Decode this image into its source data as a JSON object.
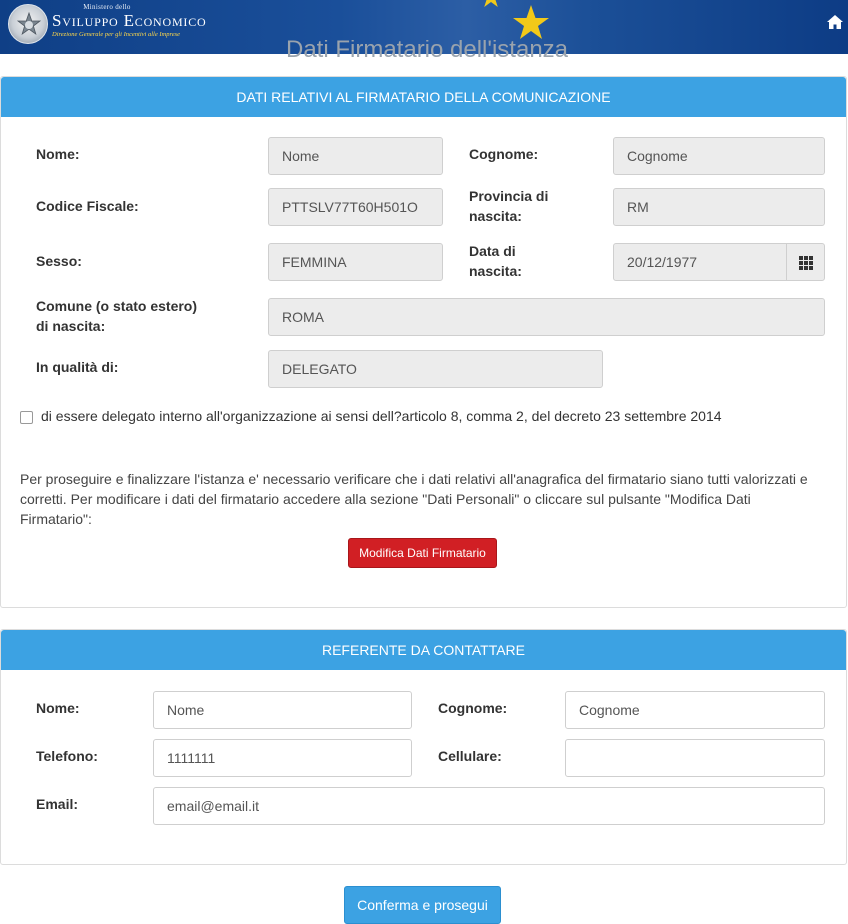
{
  "header": {
    "ministry_small": "Ministero dello",
    "ministry_name": "Sviluppo Economico",
    "ministry_sub": "Direzione Generale per gli Incentivi alle Imprese",
    "logo_icon": "republic-emblem-icon",
    "home_icon": "home-icon"
  },
  "page_title": "Dati Firmatario dell'istanza",
  "firmatario": {
    "heading": "DATI RELATIVI AL FIRMATARIO DELLA COMUNICAZIONE",
    "nome_label": "Nome:",
    "nome_value": "Nome",
    "cognome_label": "Cognome:",
    "cognome_value": "Cognome",
    "cf_label": "Codice Fiscale:",
    "cf_value": "PTTSLV77T60H501O",
    "provincia_label_1": "Provincia di",
    "provincia_label_2": "nascita:",
    "provincia_value": "RM",
    "sesso_label": "Sesso:",
    "sesso_value": "FEMMINA",
    "data_label_1": "Data di",
    "data_label_2": "nascita:",
    "data_value": "20/12/1977",
    "calendar_icon": "calendar-grid-icon",
    "comune_label_1": "Comune (o stato estero)",
    "comune_label_2": "di nascita:",
    "comune_value": "ROMA",
    "qualita_label": "In qualità di:",
    "qualita_value": "DELEGATO",
    "checkbox_label": "di essere delegato interno all'organizzazione ai sensi dell?articolo 8, comma 2, del decreto 23 settembre 2014",
    "checkbox_checked": false,
    "note": "Per proseguire e finalizzare l'istanza e' necessario verificare che i dati relativi all'anagrafica del firmatario siano tutti valorizzati e corretti. Per modificare i dati del firmatario accedere alla sezione \"Dati Personali\" o cliccare sul pulsante \"Modifica Dati Firmatario\":",
    "modifica_button": "Modifica Dati Firmatario"
  },
  "referente": {
    "heading": "REFERENTE DA CONTATTARE",
    "nome_label": "Nome:",
    "nome_value": "Nome",
    "cognome_label": "Cognome:",
    "cognome_value": "Cognome",
    "telefono_label": "Telefono:",
    "telefono_value": "1111111",
    "cellulare_label": "Cellulare:",
    "cellulare_value": "",
    "email_label": "Email:",
    "email_value": "email@email.it"
  },
  "confirm_button": "Conferma e prosegui",
  "colors": {
    "header_blue": "#1a4f9a",
    "panel_head": "#3ca2e3",
    "modify_red": "#d11f24",
    "confirm_blue": "#3ca2e3"
  }
}
